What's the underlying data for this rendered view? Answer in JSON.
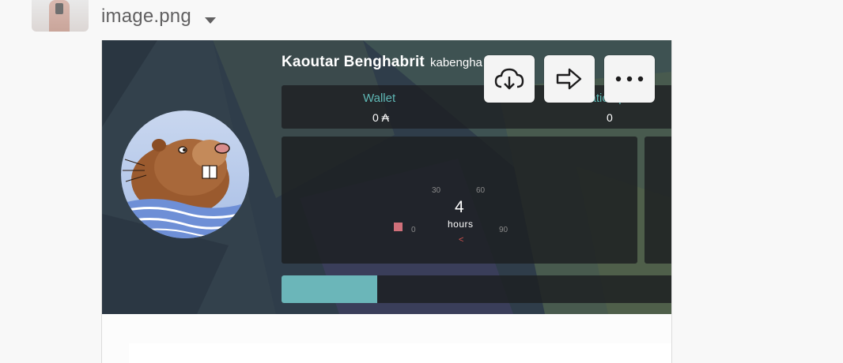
{
  "message": {
    "filename": "image.png",
    "menu_icon": "caret-down-icon",
    "avatar_icon": "user-avatar"
  },
  "actions": [
    {
      "name": "download-button",
      "icon": "cloud-download-icon"
    },
    {
      "name": "share-button",
      "icon": "arrow-right-icon"
    },
    {
      "name": "more-actions-button",
      "icon": "ellipsis-icon"
    }
  ],
  "profile": {
    "name": "Kaoutar Benghabrit",
    "login": "kabengha",
    "wallet_label": "Wallet",
    "wallet_value": "0 ₳",
    "evaluation_label": "Evaluation points",
    "evaluation_value": "0"
  },
  "logtime": {
    "ticks": [
      "30",
      "60",
      "0",
      "90"
    ],
    "value": "4",
    "unit": "hours",
    "prev_label": "<",
    "progress_fraction": 0.245
  },
  "colors": {
    "accent": "#5fb8b5",
    "progress": "#6bb6b9",
    "banner": "#2f3d4a"
  }
}
